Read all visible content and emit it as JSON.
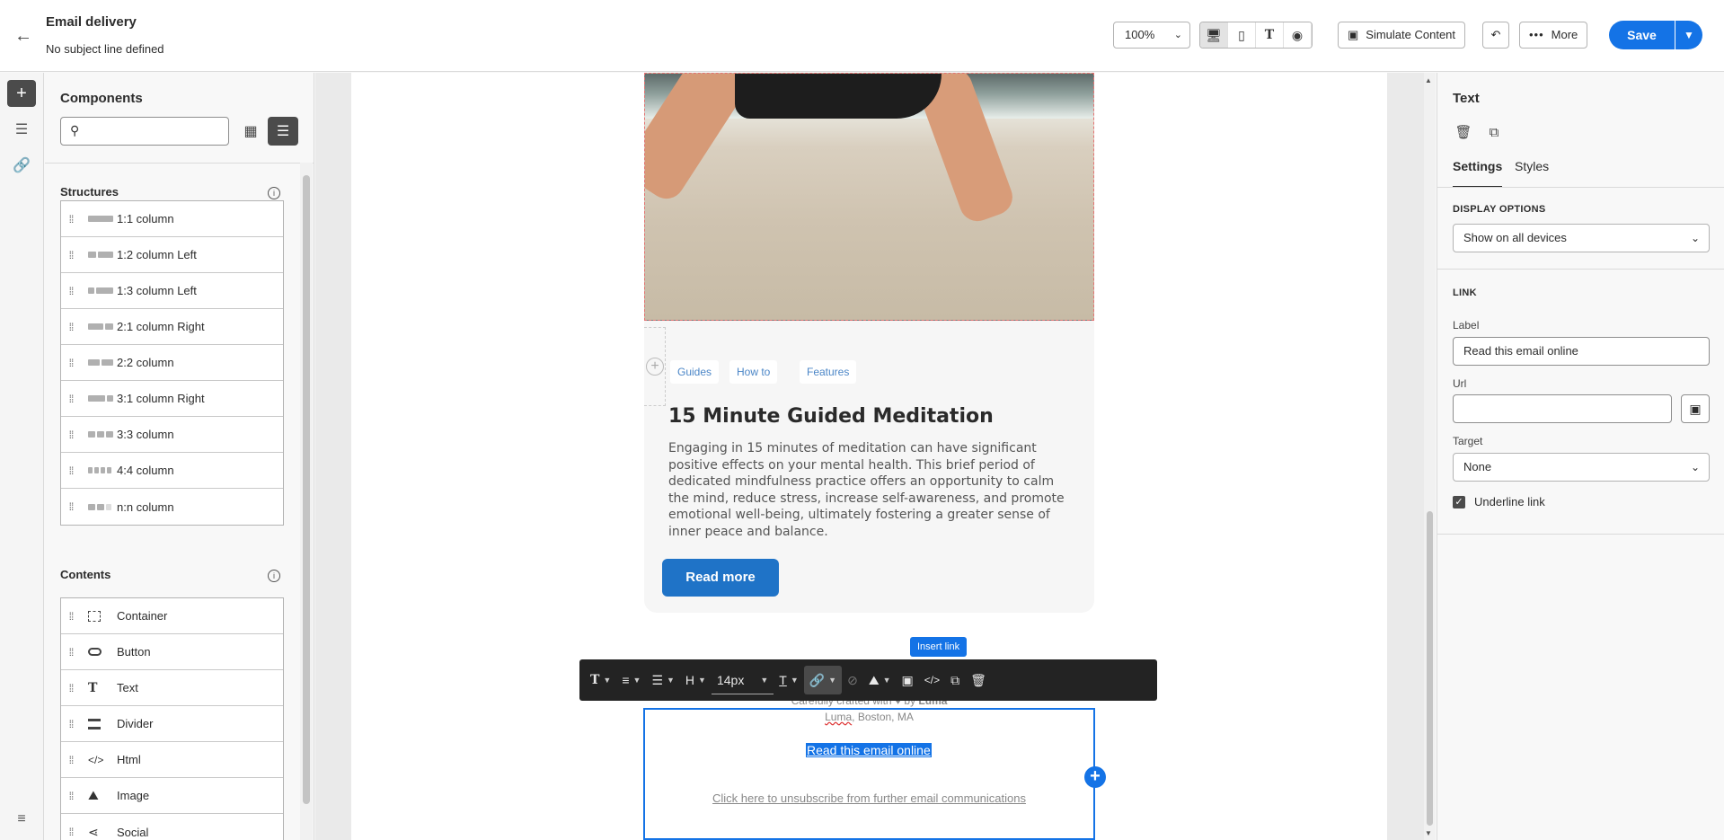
{
  "header": {
    "title": "Email delivery",
    "subtitle": "No subject line defined",
    "zoom": "100%",
    "simulate_label": "Simulate Content",
    "more_label": "More",
    "save_label": "Save"
  },
  "left_panel": {
    "title": "Components",
    "search_placeholder": "",
    "structures_title": "Structures",
    "structures": [
      {
        "label": "1:1 column"
      },
      {
        "label": "1:2 column Left"
      },
      {
        "label": "1:3 column Left"
      },
      {
        "label": "2:1 column Right"
      },
      {
        "label": "2:2 column"
      },
      {
        "label": "3:1 column Right"
      },
      {
        "label": "3:3 column"
      },
      {
        "label": "4:4 column"
      },
      {
        "label": "n:n column"
      }
    ],
    "contents_title": "Contents",
    "contents": [
      {
        "label": "Container",
        "icon": "container-icon"
      },
      {
        "label": "Button",
        "icon": "button-icon"
      },
      {
        "label": "Text",
        "icon": "text-icon"
      },
      {
        "label": "Divider",
        "icon": "divider-icon"
      },
      {
        "label": "Html",
        "icon": "code-icon"
      },
      {
        "label": "Image",
        "icon": "image-icon"
      },
      {
        "label": "Social",
        "icon": "share-icon"
      }
    ]
  },
  "email": {
    "tags": [
      "Guides",
      "How to",
      "Features"
    ],
    "card_title": "15 Minute Guided Meditation",
    "card_body": "Engaging in 15 minutes of meditation can have significant positive effects on your mental health. This brief period of dedicated mindfulness practice offers an opportunity to calm the mind, reduce stress, increase self-awareness, and promote emotional well-being, ultimately fostering a greater sense of inner peace and balance.",
    "read_more": "Read more",
    "footer_crafted_prefix": "Carefully crafted with ♥ by",
    "footer_brand": "Luma",
    "footer_city_brand": "Luma",
    "footer_city_rest": ", Boston, MA",
    "read_online": "Read this email online",
    "unsubscribe": "Click here to unsubscribe from further email communications"
  },
  "toolbar": {
    "font_size": "14px",
    "heading": "H",
    "tooltip": "Insert link"
  },
  "right_panel": {
    "title": "Text",
    "tabs": [
      "Settings",
      "Styles"
    ],
    "display_options_label": "DISPLAY OPTIONS",
    "display_options_value": "Show on all devices",
    "link_section_label": "LINK",
    "label_field_label": "Label",
    "label_field_value": "Read this email online",
    "url_field_label": "Url",
    "url_field_value": "",
    "target_label": "Target",
    "target_value": "None",
    "underline_label": "Underline link",
    "underline_checked": true
  },
  "colors": {
    "accent": "#1473e6",
    "button_blue": "#1f73c7",
    "toolbar_bg": "#232323"
  }
}
